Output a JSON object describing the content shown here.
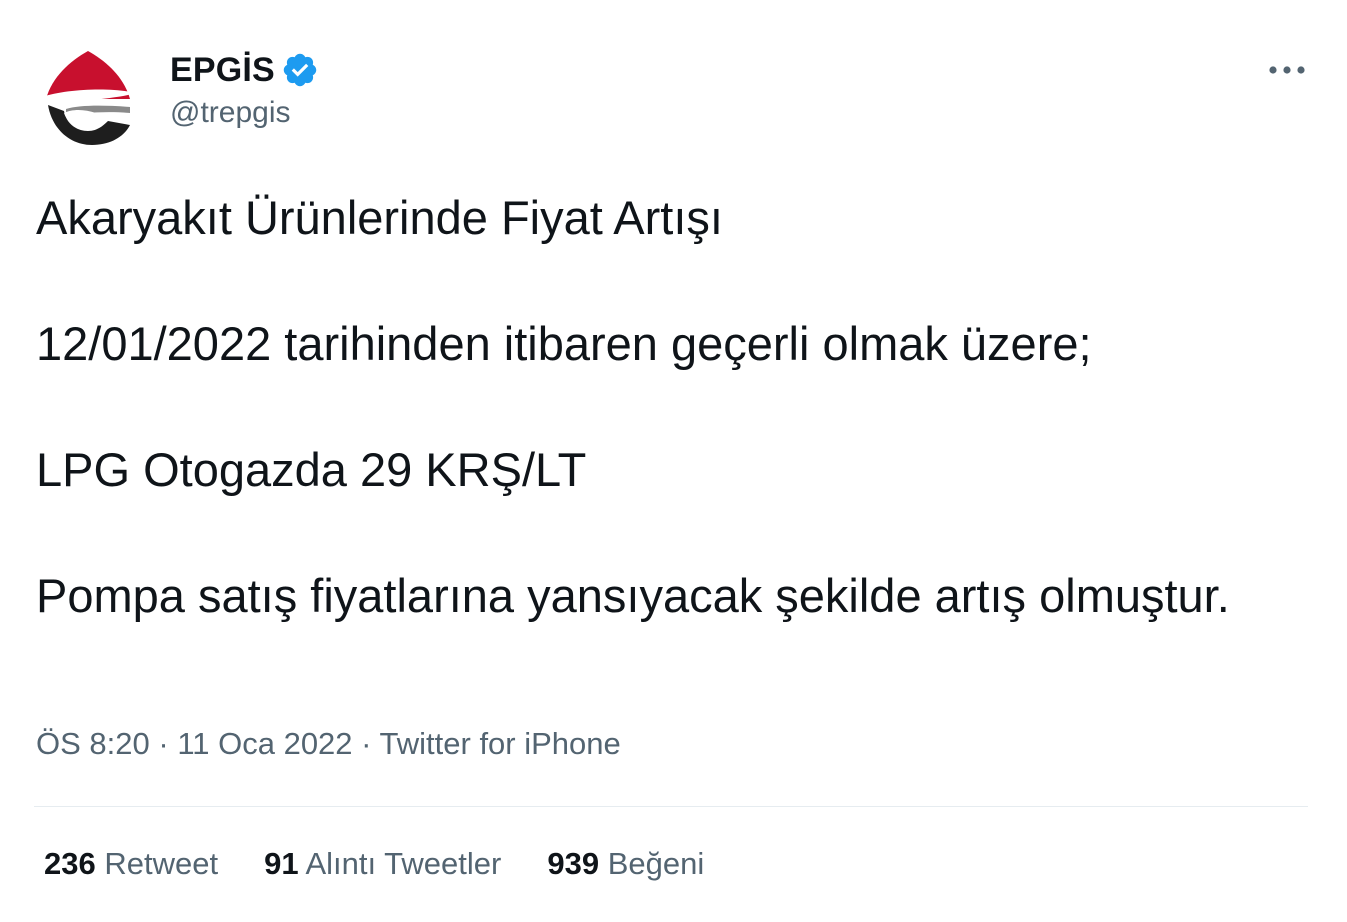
{
  "author": {
    "display_name": "EPGİS",
    "handle": "@trepgis",
    "verified_icon": "verified-badge-icon",
    "avatar_icon": "epgis-logo",
    "brand_red": "#c8102e",
    "verified_color": "#1d9bf0"
  },
  "menu": {
    "more_icon": "more-dots-icon"
  },
  "tweet": {
    "lines": [
      "Akaryakıt Ürünlerinde Fiyat Artışı",
      "12/01/2022 tarihinden itibaren geçerli olmak üzere;",
      "LPG Otogazda 29 KRŞ/LT",
      "Pompa satış fiyatlarına yansıyacak şekilde artış olmuştur."
    ]
  },
  "meta": {
    "time": "ÖS 8:20",
    "separator": " · ",
    "date": "11 Oca 2022",
    "source": "Twitter for iPhone"
  },
  "stats": {
    "retweets_count": "236",
    "retweets_label": "Retweet",
    "quotes_count": "91",
    "quotes_label": "Alıntı Tweetler",
    "likes_count": "939",
    "likes_label": "Beğeni"
  },
  "colors": {
    "text_primary": "#0f1419",
    "text_secondary": "#536471",
    "divider": "#e6ecf0"
  }
}
